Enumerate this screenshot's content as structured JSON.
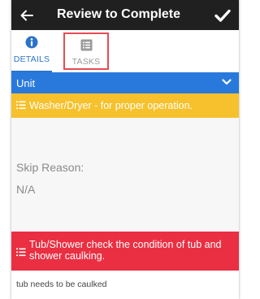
{
  "header": {
    "title": "Review to Complete",
    "back_icon": "arrow-left-icon",
    "confirm_icon": "checkmark-icon"
  },
  "tabs": [
    {
      "label": "DETAILS",
      "icon": "info-circle-icon",
      "active": true
    },
    {
      "label": "TASKS",
      "icon": "list-icon",
      "active": false
    }
  ],
  "unit": {
    "label": "Unit",
    "icon": "chevron-down-icon"
  },
  "tasks": [
    {
      "text": "Washer/Dryer -  for proper operation.",
      "icon": "task-list-icon",
      "color": "#f6c12c"
    },
    {
      "text": "Tub/Shower check the condition of tub and shower caulking.",
      "icon": "task-list-icon",
      "color": "#ea2f42"
    }
  ],
  "skip": {
    "label": "Skip Reason:",
    "value": "N/A"
  },
  "note": {
    "text": "tub needs to be caulked"
  },
  "colors": {
    "header_bg": "#202020",
    "accent_blue": "#2a73c9",
    "unit_bar": "#2979dc",
    "highlight_border": "#e94a55"
  }
}
